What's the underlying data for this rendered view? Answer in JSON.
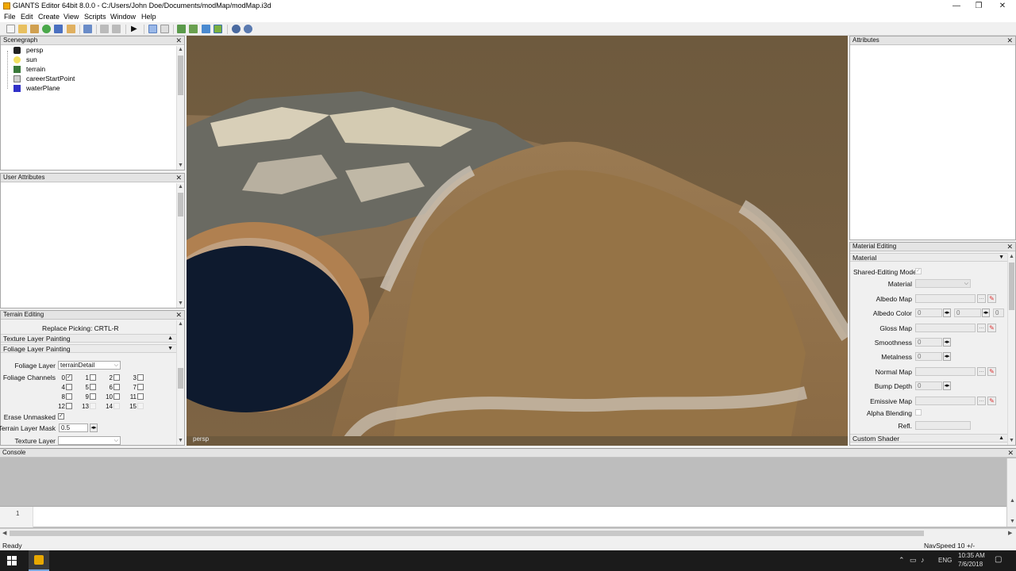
{
  "window": {
    "title": "GIANTS Editor 64bit 8.0.0 - C:/Users/John Doe/Documents/modMap/modMap.i3d",
    "minimize": "—",
    "maximize": "❐",
    "close": "✕"
  },
  "menu": [
    "File",
    "Edit",
    "Create",
    "View",
    "Scripts",
    "Window",
    "Help"
  ],
  "scenegraph": {
    "title": "Scenegraph",
    "items": [
      {
        "label": "persp",
        "icon": "camera-icon"
      },
      {
        "label": "sun",
        "icon": "light-bulb-icon"
      },
      {
        "label": "terrain",
        "icon": "terrain-icon"
      },
      {
        "label": "careerStartPoint",
        "icon": "transform-group-icon"
      },
      {
        "label": "waterPlane",
        "icon": "shape-cube-icon"
      }
    ]
  },
  "user_attributes": {
    "title": "User Attributes"
  },
  "terrain_editing": {
    "title": "Terrain Editing",
    "replace_picking": "Replace Picking: CRTL-R",
    "texture_section": "Texture Layer Painting",
    "foliage_section": "Foliage Layer Painting",
    "foliage_layer_label": "Foliage Layer",
    "foliage_layer_value": "terrainDetail",
    "foliage_channels_label": "Foliage Channels",
    "channels": [
      "0",
      "1",
      "2",
      "3",
      "4",
      "5",
      "6",
      "7",
      "8",
      "9",
      "10",
      "11",
      "12",
      "13",
      "14",
      "15"
    ],
    "erase_unmasked_label": "Erase Unmasked",
    "terrain_layer_mask_label": "Terrain Layer Mask",
    "terrain_layer_mask_value": "0.5",
    "texture_layer_label": "Texture Layer"
  },
  "viewport": {
    "camera_label": "persp"
  },
  "attributes": {
    "title": "Attributes"
  },
  "material_editing": {
    "title": "Material Editing",
    "section": "Material",
    "shared_editing_label": "Shared-Editing Mode",
    "material_label": "Material",
    "albedo_map_label": "Albedo Map",
    "albedo_color_label": "Albedo Color",
    "albedo_color_values": [
      "0",
      "0",
      "0"
    ],
    "gloss_map_label": "Gloss Map",
    "smoothness_label": "Smoothness",
    "smoothness_value": "0",
    "metalness_label": "Metalness",
    "metalness_value": "0",
    "normal_map_label": "Normal Map",
    "bump_depth_label": "Bump Depth",
    "bump_depth_value": "0",
    "emissive_map_label": "Emissive Map",
    "alpha_blending_label": "Alpha Blending",
    "refl_label": "Refl.",
    "custom_shader_section": "Custom Shader"
  },
  "console": {
    "title": "Console",
    "line_number": "1"
  },
  "status": {
    "left": "Ready",
    "right": "NavSpeed 10 +/-"
  },
  "taskbar": {
    "language": "ENG",
    "time": "10:35 AM",
    "date": "7/6/2018"
  }
}
